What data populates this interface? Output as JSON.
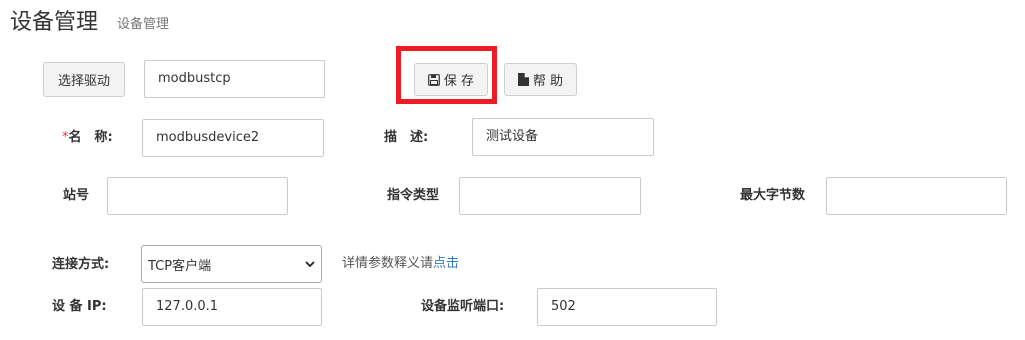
{
  "header": {
    "title": "设备管理",
    "subtitle": "设备管理"
  },
  "toolbar": {
    "select_driver_label": "选择驱动",
    "driver_value": "modbustcp",
    "save_label": "保 存",
    "help_label": "帮 助",
    "save_icon": "floppy-disk-icon",
    "help_icon": "file-icon"
  },
  "form": {
    "name": {
      "required_mark": "*",
      "label": "名　称:",
      "value": "modbusdevice2"
    },
    "description": {
      "label": "描　述:",
      "value": "测试设备"
    },
    "station": {
      "label": "站号",
      "value": ""
    },
    "command_type": {
      "label": "指令类型",
      "value": ""
    },
    "max_bytes": {
      "label": "最大字节数",
      "value": ""
    },
    "connection": {
      "label": "连接方式:",
      "selected": "TCP客户端"
    },
    "help_note": {
      "text": "详情参数释义请",
      "link": "点击"
    },
    "device_ip": {
      "label": "设 备 IP:",
      "value": "127.0.0.1"
    },
    "listen_port": {
      "label": "设备监听端口:",
      "value": "502"
    }
  },
  "colors": {
    "highlight": "#ee1c25",
    "link": "#337ab7",
    "required": "#e4393c"
  }
}
